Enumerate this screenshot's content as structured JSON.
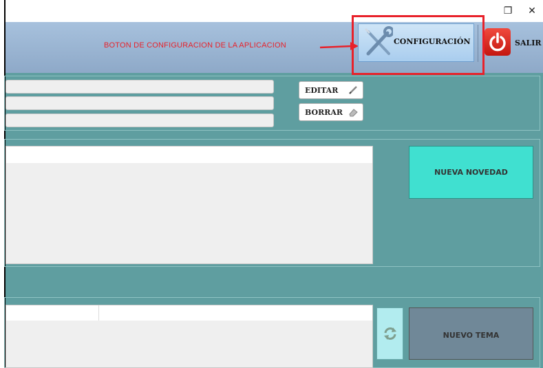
{
  "window": {
    "restore_glyph": "❐",
    "close_glyph": "✕"
  },
  "toolbar": {
    "annotation_text": "BOTON DE CONFIGURACION DE LA APLICACION",
    "config_label": "CONFIGURACIÓN",
    "exit_label": "SALIR"
  },
  "form": {
    "fields": [
      "",
      "",
      ""
    ],
    "edit_label": "EDITAR",
    "delete_label": "BORRAR"
  },
  "news": {
    "new_button_label": "NUEVA NOVEDAD"
  },
  "topics": {
    "new_button_label": "NUEVO TEMA"
  },
  "colors": {
    "panel_bg": "#5f9ea0",
    "toolbar_bg": "#a7c1dd",
    "highlight": "#e8212a",
    "new_news_bg": "#40e0d0",
    "new_topic_bg": "#708898"
  },
  "icons": {
    "config": "wrench-screwdriver-icon",
    "exit": "power-icon",
    "edit": "pencil-icon",
    "delete": "eraser-icon",
    "refresh": "refresh-icon"
  }
}
